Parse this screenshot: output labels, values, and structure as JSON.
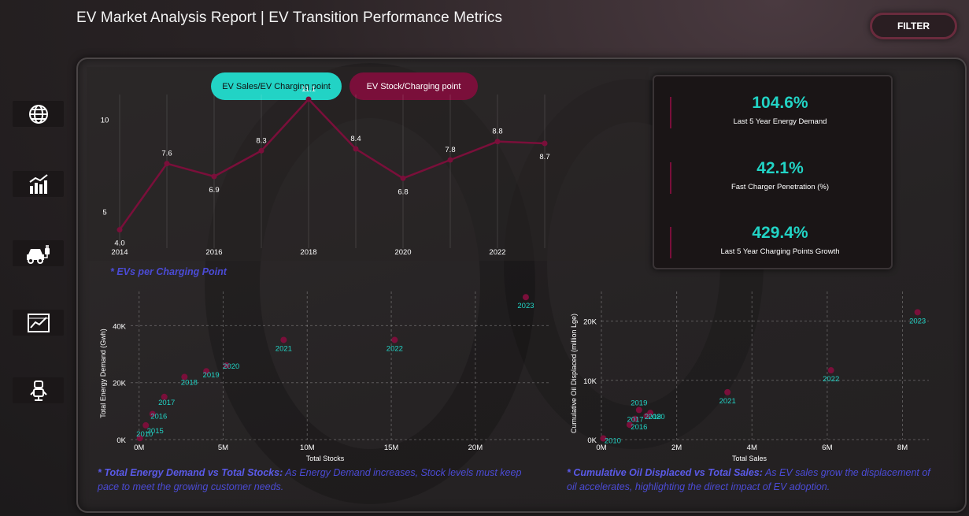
{
  "header": {
    "title": "EV Market Analysis Report | EV Transition Performance Metrics",
    "filter_label": "FILTER"
  },
  "sidebar": {
    "items": [
      {
        "icon": "globe-icon"
      },
      {
        "icon": "bar-chart-icon"
      },
      {
        "icon": "ev-car-icon"
      },
      {
        "icon": "line-chart-icon"
      },
      {
        "icon": "robot-icon"
      }
    ]
  },
  "toggles": {
    "sales_label": "EV Sales/EV Charging point",
    "stock_label": "EV Stock/Charging point"
  },
  "kpis": [
    {
      "value": "104.6%",
      "label": "Last 5 Year Energy Demand"
    },
    {
      "value": "42.1%",
      "label": "Fast Charger Penetration (%)"
    },
    {
      "value": "429.4%",
      "label": "Last 5 Year Charging Points Growth"
    }
  ],
  "captions": {
    "line": "* EVs per Charging Point",
    "scatter1_bold": "* Total Energy Demand vs Total Stocks:",
    "scatter1_text": " As Energy Demand increases, Stock levels must keep pace to meet the growing customer needs.",
    "scatter2_bold": "* Cumulative Oil Displaced vs Total Sales:",
    "scatter2_text": " As EV sales grow the displacement of oil accelerates, highlighting the direct impact of EV adoption."
  },
  "colors": {
    "accent": "#22d3c5",
    "series": "#7a0f3a",
    "caption": "#4b4bd6"
  },
  "chart_data": [
    {
      "type": "line",
      "x": [
        2014,
        2015,
        2016,
        2017,
        2018,
        2019,
        2020,
        2021,
        2022,
        2023
      ],
      "values": [
        4.0,
        7.6,
        6.9,
        8.3,
        11.1,
        8.4,
        6.8,
        7.8,
        8.8,
        8.7
      ],
      "labels": [
        "4.0",
        "7.6",
        "6.9",
        "8.3",
        "11.1",
        "8.4",
        "6.8",
        "7.8",
        "8.8",
        "8.7"
      ],
      "xticks": [
        "2014",
        "2016",
        "2018",
        "2020",
        "2022"
      ],
      "yticks": [
        "5",
        "10"
      ],
      "ylim": [
        3,
        12
      ],
      "grid": false
    },
    {
      "type": "scatter",
      "xlabel": "Total Stocks",
      "ylabel": "Total Energy Demand (Gwh)",
      "xticks": [
        "0M",
        "5M",
        "10M",
        "15M",
        "20M"
      ],
      "xtick_values": [
        0,
        5,
        10,
        15,
        20
      ],
      "yticks": [
        "0K",
        "20K",
        "40K"
      ],
      "ytick_values": [
        0,
        20,
        40
      ],
      "xlim": [
        -0.5,
        24.5
      ],
      "ylim": [
        0,
        52
      ],
      "points": [
        {
          "label": "2010",
          "x": 0.05,
          "y": 0.5
        },
        {
          "label": "2015",
          "x": 0.4,
          "y": 5
        },
        {
          "label": "2016",
          "x": 0.8,
          "y": 9
        },
        {
          "label": "2017",
          "x": 1.5,
          "y": 15
        },
        {
          "label": "2018",
          "x": 2.7,
          "y": 22
        },
        {
          "label": "2019",
          "x": 4.0,
          "y": 24
        },
        {
          "label": "2020",
          "x": 5.2,
          "y": 26
        },
        {
          "label": "2021",
          "x": 8.6,
          "y": 35
        },
        {
          "label": "2022",
          "x": 15.2,
          "y": 35
        },
        {
          "label": "2023",
          "x": 23.0,
          "y": 50
        }
      ]
    },
    {
      "type": "scatter",
      "xlabel": "Total Sales",
      "ylabel": "Cumulative Oil Displaced (million Lge)",
      "xticks": [
        "0M",
        "2M",
        "4M",
        "6M",
        "8M"
      ],
      "xtick_values": [
        0,
        2,
        4,
        6,
        8
      ],
      "yticks": [
        "0K",
        "10K",
        "20K"
      ],
      "ytick_values": [
        0,
        10,
        20
      ],
      "xlim": [
        0,
        8.7
      ],
      "ylim": [
        0,
        25
      ],
      "points": [
        {
          "label": "2010",
          "x": 0.05,
          "y": 0.2
        },
        {
          "label": "2016",
          "x": 0.75,
          "y": 2.5
        },
        {
          "label": "2017",
          "x": 0.9,
          "y": 3.5
        },
        {
          "label": "2019",
          "x": 1.0,
          "y": 5.0
        },
        {
          "label": "2018",
          "x": 1.2,
          "y": 4.0
        },
        {
          "label": "2020",
          "x": 1.3,
          "y": 4.5
        },
        {
          "label": "2021",
          "x": 3.35,
          "y": 8.0
        },
        {
          "label": "2022",
          "x": 6.1,
          "y": 11.7
        },
        {
          "label": "2023",
          "x": 8.4,
          "y": 21.5
        }
      ]
    }
  ]
}
